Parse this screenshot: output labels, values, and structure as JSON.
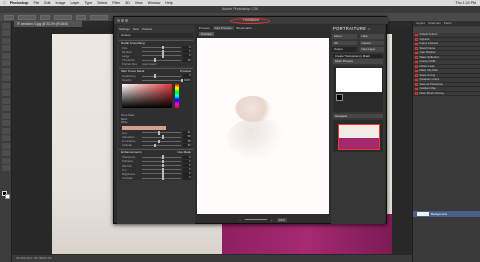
{
  "menubar": {
    "app": "Photoshop",
    "items": [
      "File",
      "Edit",
      "Image",
      "Layer",
      "Type",
      "Select",
      "Filter",
      "3D",
      "View",
      "Window",
      "Help"
    ],
    "clock": "Thu 1:24 PM"
  },
  "ps": {
    "title": "Adobe Photoshop CS6",
    "doc_tab": "IF-newborn-V.jpg @ 33.3% (RGB/8)",
    "status": "33.33%    Doc: 25.7M/25.7M"
  },
  "dialog": {
    "title": "Portraiture",
    "settings_label": "Settings",
    "new_label": "New",
    "presets_label": "Presets",
    "preset_value": "Default",
    "preview_label": "Preview",
    "add_preview": "Add Preview",
    "bookmarks": "Bookmarks",
    "zoom": "33%",
    "brand": "PORTRAITURE",
    "version": "2",
    "about": "About",
    "help": "Help",
    "ok": "OK",
    "cancel": "Cancel",
    "output_label": "Output",
    "output_value": "New Layer",
    "create_transparency": "Create Transparency Mask",
    "mask_preview": "Mask Preview",
    "navigator": "Navigator",
    "sections": {
      "detail": {
        "title": "Detail Smoothing",
        "rows": [
          {
            "name": "Fine",
            "value": "0",
            "level": 0.5
          },
          {
            "name": "Medium",
            "value": "0",
            "level": 0.5
          },
          {
            "name": "Large",
            "value": "0",
            "level": 0.5
          },
          {
            "name": "Threshold",
            "value": "20",
            "level": 0.3
          }
        ],
        "preset_label": "Portrait Size",
        "preset_value": "Auto Detect"
      },
      "skin": {
        "title": "Skin Tones Mask",
        "preset": "Preview",
        "rows": [
          {
            "name": "Feathering",
            "value": "0",
            "level": 0.3
          },
          {
            "name": "Opacity",
            "value": "100%",
            "level": 1.0
          },
          {
            "name": "Hue",
            "value": "21",
            "level": 0.4
          },
          {
            "name": "Saturation",
            "value": "50",
            "level": 0.5
          },
          {
            "name": "Luminance",
            "value": "38",
            "level": 0.4
          },
          {
            "name": "Latitude",
            "value": "30",
            "level": 0.3
          }
        ],
        "mask_options": [
          "Show Mask",
          "Black",
          "White"
        ]
      },
      "enhance": {
        "title": "Enhancements",
        "preset": "Use Mask",
        "rows": [
          {
            "name": "Sharpness",
            "value": "0",
            "level": 0.5
          },
          {
            "name": "Softness",
            "value": "0",
            "level": 0.5
          },
          {
            "name": "Warmth",
            "value": "0",
            "level": 0.5
          },
          {
            "name": "Tint",
            "value": "0",
            "level": 0.5
          },
          {
            "name": "Brightness",
            "value": "0",
            "level": 0.5
          },
          {
            "name": "Contrast",
            "value": "0",
            "level": 0.5
          }
        ]
      }
    }
  },
  "layers": {
    "tabs": [
      "Layers",
      "Channels",
      "Paths"
    ],
    "actions": [
      "Default Actions",
      "Vignette",
      "Frame Channel",
      "Wood Frame",
      "Cast Shadow",
      "Water Reflection",
      "Custom RGB",
      "Molten Lead",
      "Make Clip Path",
      "Sepia Toning",
      "Quadrant Colors",
      "Save As Photoshop",
      "Gradient Map",
      "Mixer Brush Cloning"
    ],
    "background_layer": "Background"
  },
  "colors": {
    "accent": "#e33333",
    "selected": "#4a5f86",
    "fabric": "#a52a72"
  }
}
